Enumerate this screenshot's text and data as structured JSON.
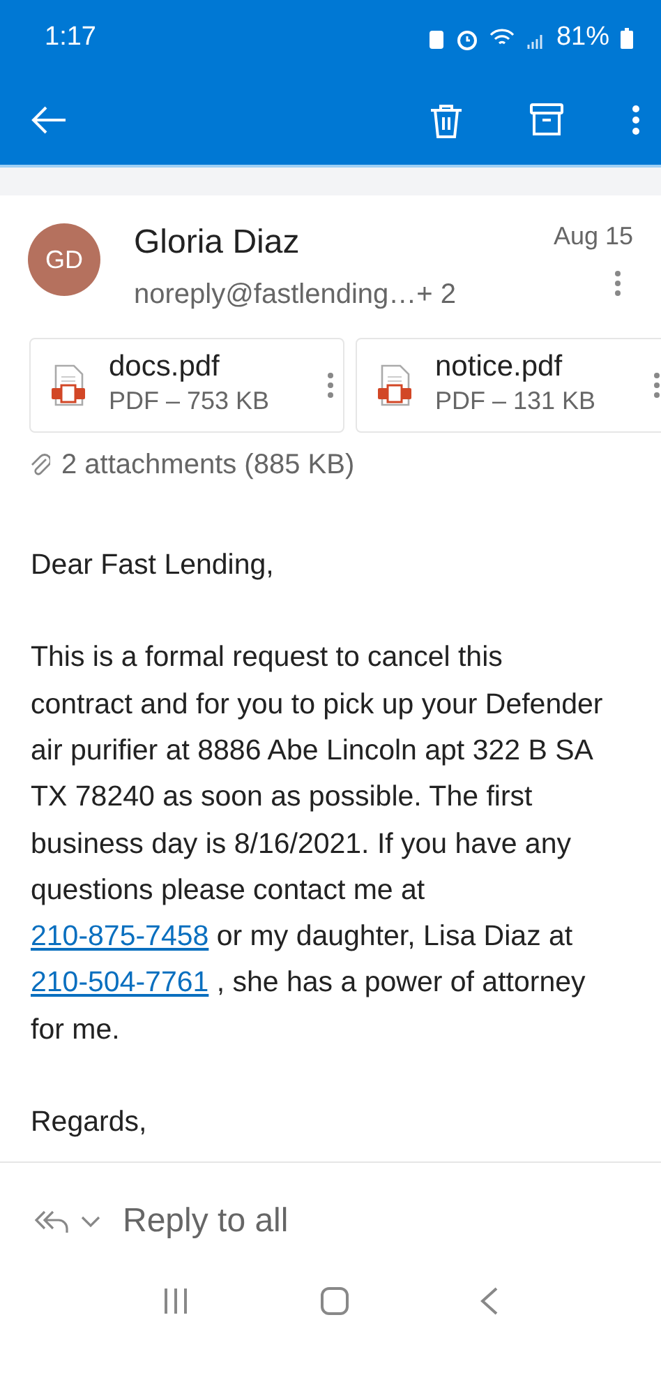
{
  "status_bar": {
    "time": "1:17",
    "battery": "81%"
  },
  "sender": {
    "initials": "GD",
    "name": "Gloria Diaz",
    "recipients": "noreply@fastlending…+ 2",
    "date": "Aug 15"
  },
  "attachments": [
    {
      "name": "docs.pdf",
      "info": "PDF – 753 KB"
    },
    {
      "name": "notice.pdf",
      "info": "PDF – 131 KB"
    }
  ],
  "attachments_summary": "2 attachments (885 KB)",
  "body": [
    [
      {
        "kind": "text",
        "text": "Dear Fast Lending,"
      }
    ],
    [
      {
        "kind": "text",
        "text": "This is a formal request to cancel this contract and for you to pick up your Defender air purifier at 8886 Abe Lincoln apt 322 B SA TX 78240 as soon as possible. The first business day is 8/16/2021.  If you have any questions please contact me at "
      },
      {
        "kind": "link",
        "text": "210-875-7458"
      },
      {
        "kind": "text",
        "text": "   or my daughter, Lisa Diaz at "
      },
      {
        "kind": "link",
        "text": "210-504-7761"
      },
      {
        "kind": "text",
        "text": " , she has a power of attorney for me."
      }
    ],
    [
      {
        "kind": "text",
        "text": "Regards,"
      }
    ]
  ],
  "reply": {
    "label": "Reply to all"
  }
}
